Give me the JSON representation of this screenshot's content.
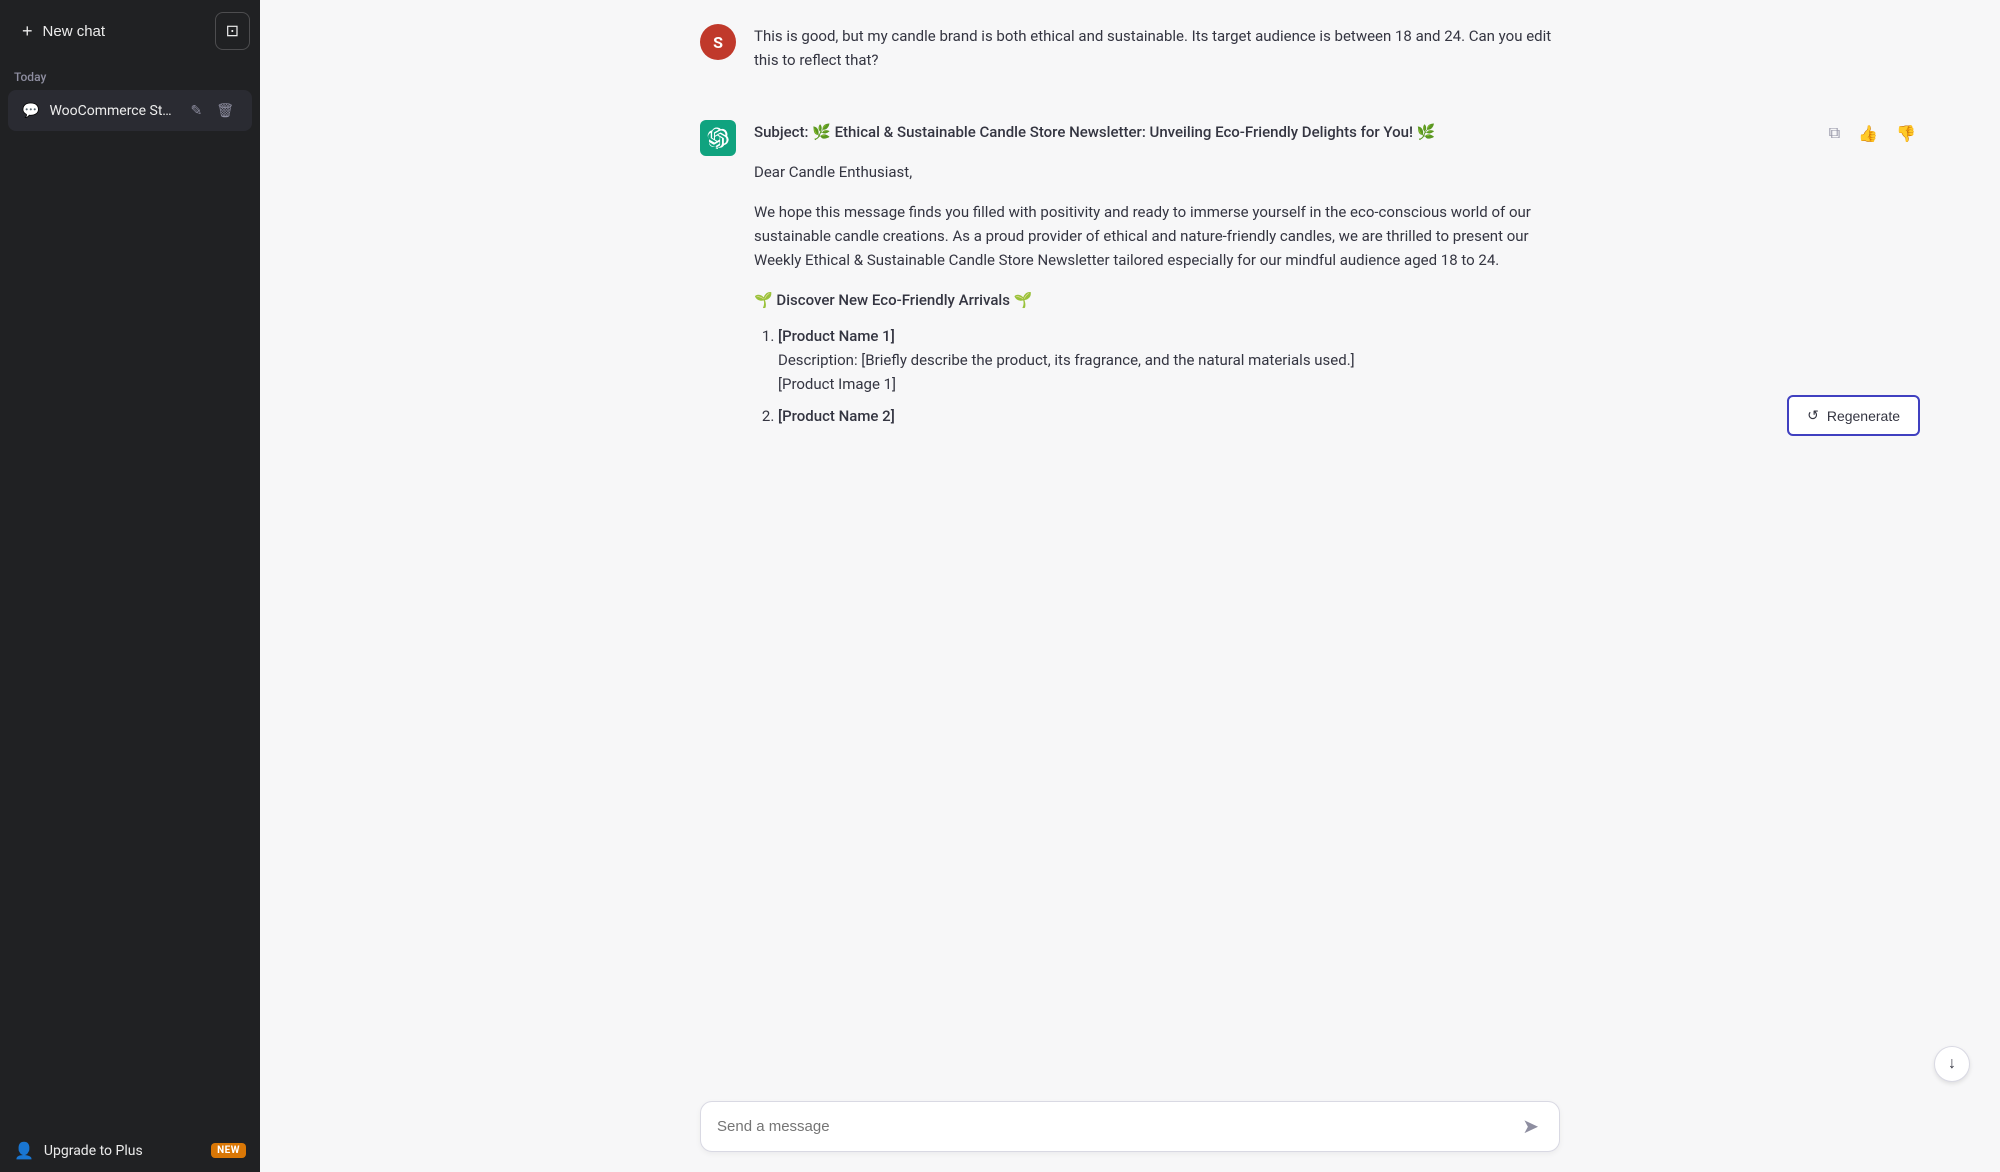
{
  "sidebar": {
    "new_chat_label": "New chat",
    "layout_icon": "⊞",
    "section_today": "Today",
    "chat_items": [
      {
        "id": "woocommerce",
        "label": "WooCommerce Store"
      }
    ],
    "footer": {
      "label": "Upgrade to Plus",
      "badge": "NEW"
    }
  },
  "chat": {
    "user_avatar_letter": "S",
    "user_message": "This is good, but my candle brand is both ethical and sustainable. Its target audience is between 18 and 24. Can you edit this to reflect that?",
    "assistant_response": {
      "subject": "Subject: 🌿 Ethical & Sustainable Candle Store Newsletter: Unveiling Eco-Friendly Delights for You! 🌿",
      "greeting": "Dear Candle Enthusiast,",
      "body": "We hope this message finds you filled with positivity and ready to immerse yourself in the eco-conscious world of our sustainable candle creations. As a proud provider of ethical and nature-friendly candles, we are thrilled to present our Weekly Ethical & Sustainable Candle Store Newsletter tailored especially for our mindful audience aged 18 to 24.",
      "section_header": "🌱 Discover New Eco-Friendly Arrivals 🌱",
      "products": [
        {
          "name": "[Product Name 1]",
          "description": "Description: [Briefly describe the product, its fragrance, and the natural materials used.]",
          "image": "[Product Image 1]"
        },
        {
          "name": "[Product Name 2]",
          "description": ""
        }
      ]
    },
    "regenerate_label": "Regenerate",
    "input_placeholder": "Send a message",
    "send_icon": "➤"
  },
  "icons": {
    "copy": "⧉",
    "thumbs_up": "👍",
    "thumbs_down": "👎",
    "edit": "✎",
    "delete": "🗑",
    "chat_bubble": "💬",
    "person": "👤",
    "regenerate": "↺",
    "scroll_down": "↓"
  }
}
